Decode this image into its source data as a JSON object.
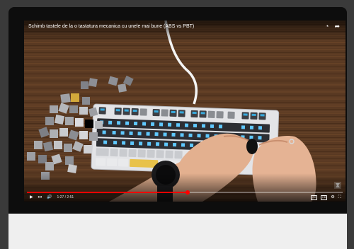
{
  "video": {
    "title": "Schimb tastele de la o tastatura mecanica cu unele mai bune (ABS vs PBT)",
    "progress_fraction": 0.51,
    "time": "1:27 / 2:51"
  },
  "icons": {
    "top": [
      "clock-icon",
      "share-icon"
    ],
    "controls_left": [
      "play-icon",
      "next-icon",
      "volume-icon"
    ],
    "controls_right": [
      "subtitles-icon",
      "hd-icon",
      "settings-icon",
      "fullscreen-icon"
    ]
  },
  "colors": {
    "progress": "#ff0000",
    "background": "#0d0d0d",
    "panel": "#efefef"
  }
}
